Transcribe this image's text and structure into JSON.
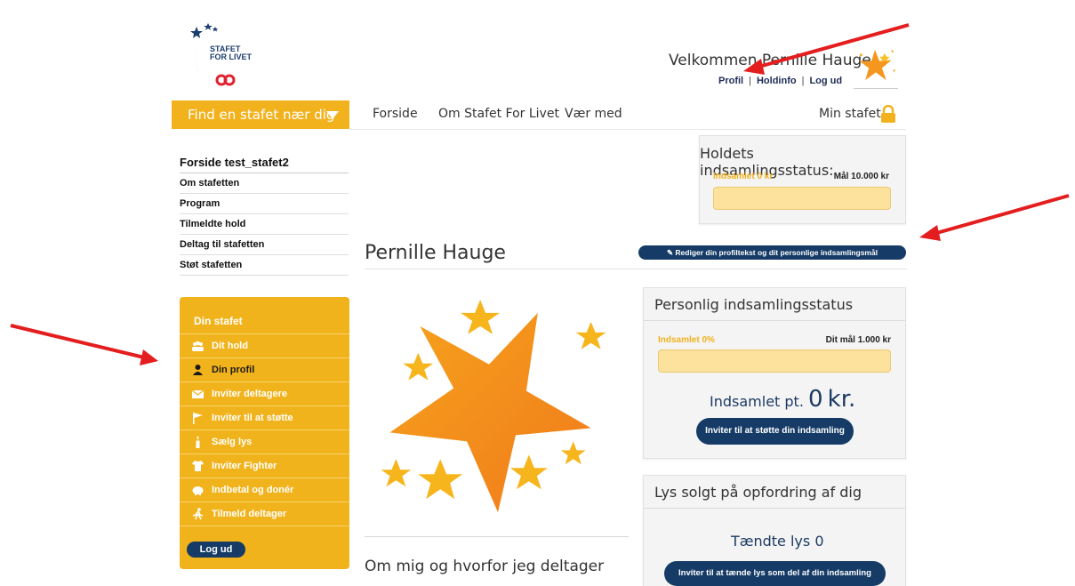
{
  "header": {
    "logo_line1": "STAFET",
    "logo_line2": "FOR LIVET",
    "welcome": "Velkommen Pernille Hauge",
    "links": [
      "Profil",
      "Holdinfo",
      "Log ud"
    ],
    "separator": "|"
  },
  "nav": {
    "find_label": "Find en stafet nær dig",
    "items": [
      "Forside",
      "Om Stafet For Livet",
      "Vær med"
    ],
    "min_stafet": "Min stafet"
  },
  "sidebar": {
    "title": "Forside test_stafet2",
    "items": [
      "Om stafetten",
      "Program",
      "Tilmeldte hold",
      "Deltag til stafetten",
      "Støt stafetten"
    ]
  },
  "din_stafet": {
    "heading": "Din stafet",
    "items": [
      {
        "label": "Dit hold",
        "icon": "team-icon"
      },
      {
        "label": "Din profil",
        "icon": "person-icon"
      },
      {
        "label": "Inviter deltagere",
        "icon": "envelope-icon"
      },
      {
        "label": "Inviter til at støtte",
        "icon": "flag-icon"
      },
      {
        "label": "Sælg lys",
        "icon": "candle-icon"
      },
      {
        "label": "Inviter Fighter",
        "icon": "tshirt-icon"
      },
      {
        "label": "Indbetal og donér",
        "icon": "piggy-bank-icon"
      },
      {
        "label": "Tilmeld deltager",
        "icon": "runner-icon"
      }
    ],
    "logout": "Log ud"
  },
  "team_status": {
    "title": "Holdets indsamlingsstatus:",
    "collected": "Indsamlet 0 kr",
    "goal": "Mål 10.000 kr",
    "progress": 0
  },
  "profile": {
    "name": "Pernille Hauge",
    "edit_button": "Rediger din profiltekst og dit personlige indsamlingsmål",
    "about_heading": "Om mig og hvorfor jeg deltager"
  },
  "personal_status": {
    "title": "Personlig indsamlingsstatus",
    "collected_pct": "Indsamlet 0%",
    "goal": "Dit mål 1.000 kr",
    "progress": 0,
    "collected_prefix": "Indsamlet pt.",
    "collected_amount": "0",
    "collected_unit": "kr.",
    "invite_button": "Inviter til at støtte din indsamling"
  },
  "lys": {
    "title": "Lys solgt på opfordring af dig",
    "count_text": "Tændte lys 0",
    "invite_button": "Inviter til at tænde lys som del af din indsamling"
  },
  "colors": {
    "accent": "#f2b21d",
    "navy": "#153b66",
    "progress_bg": "#fde29d",
    "arrow": "#e41e1e"
  }
}
